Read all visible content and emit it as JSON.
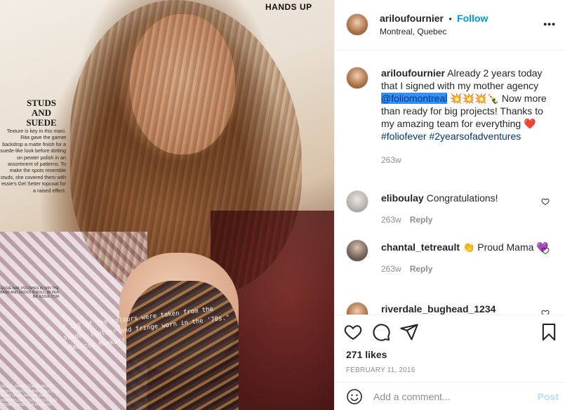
{
  "photo": {
    "magazine_header": "HANDS UP",
    "sidebar_title": "STUDS AND SUEDE",
    "sidebar_text": "Texture is key in this mani. Rita gave the garnet backdrop a matte finish for a suede-like look before dotting on pewter polish in an assortment of patterns. To make the spots resemble studs, she covered them with essie's Gel Setter topcoat for a raised effect.",
    "sidebar_credit": "ESSIE NAIL POLISHES IN WIN THE BAND AND FROCK N ROLL, $9 PER BA. ESSIE.COM",
    "handwritten_quote": "A lot of the colours were taken from the suede, leather and fringe worn in the '70s.\" -Rebecca Minkoff",
    "dress_credit": "DRESS (REBECCA MINKOFF SASH REBECCAMINKOFF.COM) SHIRT (ANN TAYLOR (SEE ANNTAYLOR.COM) SHOULDER STRAP (REBECCA MINKOFF"
  },
  "header": {
    "username": "ariloufournier",
    "separator": "•",
    "follow_label": "Follow",
    "location": "Montreal, Quebec",
    "more_label": "•••"
  },
  "caption": {
    "username": "ariloufournier",
    "text_before": "Already 2 years today that I signed with my mother agency",
    "mention": "@foliomontreal",
    "emojis": "💥💥💥🍾",
    "text_after": "Now more than ready for big projects! Thanks to my amazing team for everything",
    "heart": "❤️",
    "hashtag1": "#foliofever",
    "hashtag2": "#2yearsofadventures",
    "time": "263w"
  },
  "comments": [
    {
      "username": "eliboulay",
      "text": "Congratulations!",
      "time": "263w",
      "reply_label": "Reply"
    },
    {
      "username": "chantal_tetreault",
      "emoji1": "👏",
      "text": "Proud Mama",
      "emoji2": "💜",
      "time": "263w",
      "reply_label": "Reply"
    },
    {
      "username": "riverdale_bughead_1234"
    }
  ],
  "actions": {
    "like_icon": "heart-outline-icon",
    "comment_icon": "comment-bubble-icon",
    "share_icon": "paper-plane-icon",
    "save_icon": "bookmark-icon",
    "likes": "271 likes",
    "date": "FEBRUARY 11, 2016"
  },
  "add_comment": {
    "emoji_icon": "smiley-icon",
    "placeholder": "Add a comment...",
    "post_label": "Post"
  },
  "colors": {
    "accent": "#0095f6",
    "text": "#262626",
    "muted": "#8e8e8e",
    "link": "#00376b",
    "heart_red": "#ed4956",
    "post_disabled": "#b2dffc",
    "border": "#efefef"
  }
}
